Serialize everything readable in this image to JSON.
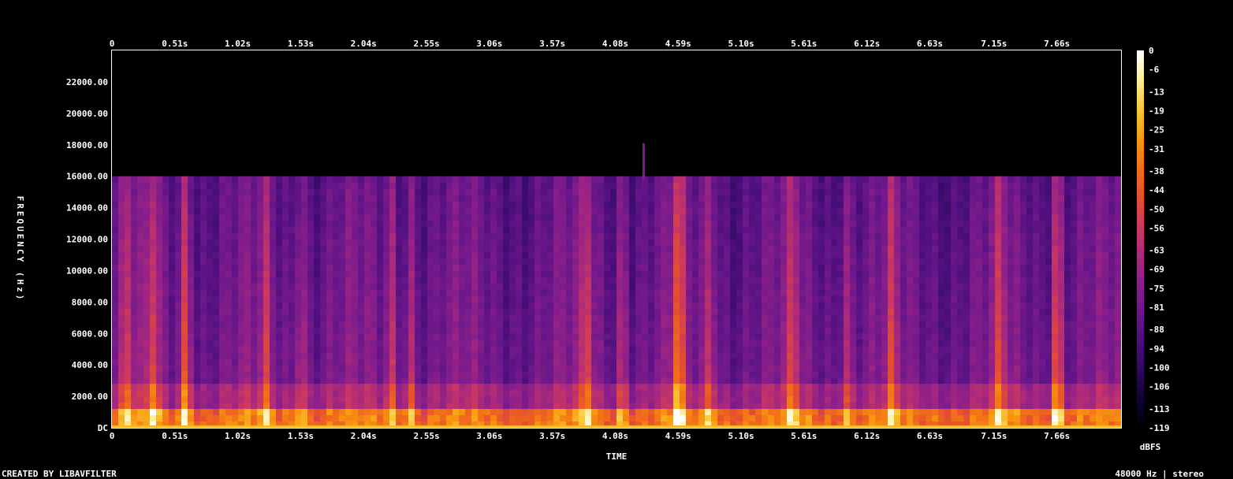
{
  "chart_data": {
    "type": "heatmap",
    "title": "",
    "xlabel": "TIME",
    "ylabel": "FREQUENCY (Hz)",
    "x_ticks": [
      "0",
      "0.51s",
      "1.02s",
      "1.53s",
      "2.04s",
      "2.55s",
      "3.06s",
      "3.57s",
      "4.08s",
      "4.59s",
      "5.10s",
      "5.61s",
      "6.12s",
      "6.63s",
      "7.15s",
      "7.66s"
    ],
    "x_tick_values": [
      0,
      0.51,
      1.02,
      1.53,
      2.04,
      2.55,
      3.06,
      3.57,
      4.08,
      4.59,
      5.1,
      5.61,
      6.12,
      6.63,
      7.15,
      7.66
    ],
    "xlim": [
      0,
      8.18
    ],
    "y_ticks": [
      "DC",
      "2000.00",
      "4000.00",
      "6000.00",
      "8000.00",
      "10000.00",
      "12000.00",
      "14000.00",
      "16000.00",
      "18000.00",
      "20000.00",
      "22000.00"
    ],
    "y_tick_values": [
      0,
      2000,
      4000,
      6000,
      8000,
      10000,
      12000,
      14000,
      16000,
      18000,
      20000,
      22000
    ],
    "ylim": [
      0,
      24000
    ],
    "colorbar_label": "dBFS",
    "colorbar_ticks": [
      "0",
      "-6",
      "-13",
      "-19",
      "-25",
      "-31",
      "-38",
      "-44",
      "-50",
      "-56",
      "-63",
      "-69",
      "-75",
      "-81",
      "-88",
      "-94",
      "-100",
      "-106",
      "-113",
      "-119"
    ],
    "colorbar_range": [
      -119,
      0
    ],
    "cutoff_frequency": 15800,
    "bursts": [
      {
        "t": 0.12,
        "strength": 0.6
      },
      {
        "t": 0.33,
        "strength": 0.7
      },
      {
        "t": 0.6,
        "strength": 0.9
      },
      {
        "t": 1.25,
        "strength": 0.5
      },
      {
        "t": 1.53,
        "strength": 0.55
      },
      {
        "t": 2.27,
        "strength": 0.5
      },
      {
        "t": 2.42,
        "strength": 0.5
      },
      {
        "t": 3.85,
        "strength": 0.7
      },
      {
        "t": 4.14,
        "strength": 0.5
      },
      {
        "t": 4.59,
        "strength": 1.0
      },
      {
        "t": 4.85,
        "strength": 0.6
      },
      {
        "t": 5.52,
        "strength": 0.6
      },
      {
        "t": 5.95,
        "strength": 0.5
      },
      {
        "t": 6.32,
        "strength": 0.5
      },
      {
        "t": 7.2,
        "strength": 0.6
      },
      {
        "t": 7.66,
        "strength": 0.95
      }
    ],
    "grid": false,
    "colormap": [
      "#000000",
      "#0c0330",
      "#2b0a5c",
      "#4a0e7a",
      "#6a178a",
      "#8b1f8a",
      "#ad2a7a",
      "#cc3860",
      "#e5502f",
      "#f27018",
      "#f99a10",
      "#fbc735",
      "#fdec8e",
      "#ffffff"
    ]
  },
  "footer": {
    "created_by": "CREATED BY LIBAVFILTER",
    "stream_info": "48000 Hz | stereo"
  }
}
